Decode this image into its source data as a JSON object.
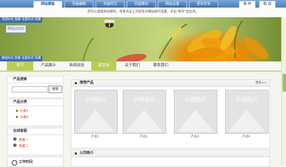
{
  "topbar": {
    "tabs": [
      "网站模板",
      "页面编辑",
      "页面样式",
      "页面模块",
      "网站设置",
      "更多优化"
    ],
    "active_tab": 0,
    "save_label": "保 存",
    "cancel_label": "取 消"
  },
  "notice": "您可以直接拖动模块，或者点击上方标签对网站进行设置，点击\"保存\"后生效。",
  "edit_row_top": [
    "顶部样式",
    "隐藏",
    "设置样式",
    "隐藏"
  ],
  "edit_row_banner": [
    "横幅样式",
    "隐藏",
    "设置样式",
    "隐藏"
  ],
  "logo_text": "网站LOGO",
  "nav": {
    "items": [
      "首页",
      "产品展示",
      "新闻动态",
      "留言板",
      "关于我们",
      "联系我们"
    ],
    "active": [
      0,
      3
    ]
  },
  "left": {
    "search_title": "产品搜索",
    "search_button": "搜索",
    "category_title": "产品分类",
    "categories": [
      "分类1",
      "分类2"
    ],
    "service_title": "在线客服",
    "service_items": [
      "客服一",
      "客服二"
    ],
    "worktime_title": "工作时间"
  },
  "products": {
    "title": "推荐产品",
    "more": "更多>>",
    "items": [
      {
        "image_label": "示例图片",
        "name": "产品1"
      },
      {
        "image_label": "示例图片",
        "name": "产品2"
      },
      {
        "image_label": "示例图片",
        "name": "产品3"
      },
      {
        "image_label": "示例图片",
        "name": "产品4"
      }
    ]
  },
  "about": {
    "title": "公司简介"
  },
  "colors": {
    "accent": "#b8cd55",
    "topbar": "#4f7fb6",
    "link": "#c0392b"
  }
}
